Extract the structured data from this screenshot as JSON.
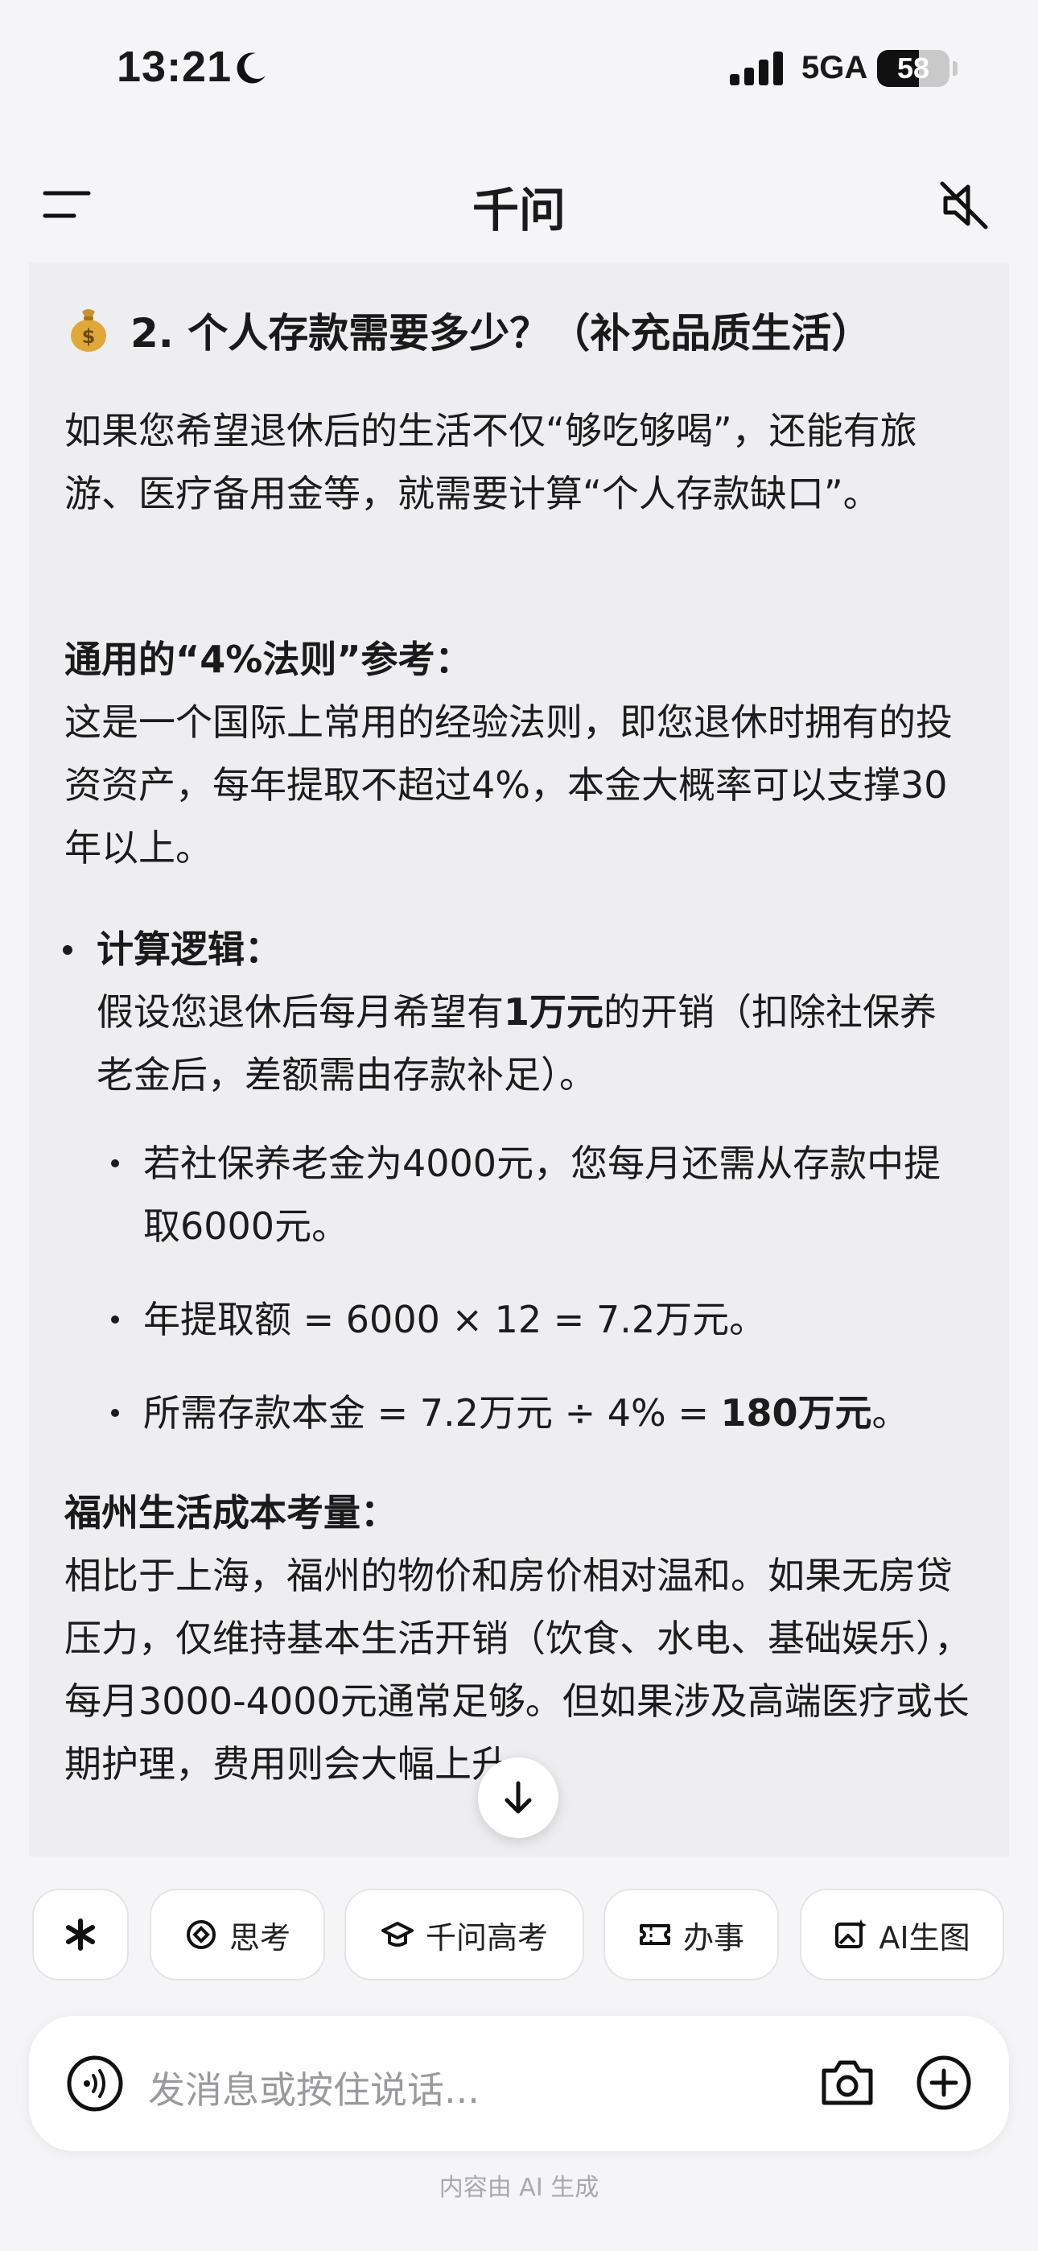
{
  "status_bar": {
    "time": "13:21",
    "network": "5GA",
    "battery": "58",
    "battery_level": 0.58
  },
  "header": {
    "title": "千问"
  },
  "content": {
    "section_title": "2. 个人存款需要多少？（补充品质生活）",
    "intro": "如果您希望退休后的生活不仅“够吃够喝”，还能有旅游、医疗备用金等，就需要计算“个人存款缺口”。",
    "rule_head": "通用的“4%法则”参考：",
    "rule_body": "这是一个国际上常用的经验法则，即您退休时拥有的投资资产，每年提取不超过4%，本金大概率可以支撑30年以上。",
    "calc_head": "计算逻辑：",
    "calc_body_pre": "假设您退休后每月希望有",
    "calc_body_bold": "1万元",
    "calc_body_post": "的开销（扣除社保养老金后，差额需由存款补足）。",
    "sub_items": [
      "若社保养老金为4000元，您每月还需从存款中提取6000元。",
      "年提取额 = 6000 × 12 = 7.2万元。"
    ],
    "sub_item_3_pre": "所需存款本金 = 7.2万元 ÷ 4% = ",
    "sub_item_3_bold": "180万元",
    "sub_item_3_post": "。",
    "fuzhou_head": "福州生活成本考量：",
    "fuzhou_body": "相比于上海，福州的物价和房价相对温和。如果无房贷压力，仅维持基本生活开销（饮食、水电、基础娱乐），每月3000-4000元通常足够。但如果涉及高端医疗或长期护理，费用则会大幅上升。"
  },
  "chips": [
    {
      "label": "",
      "icon": "asterisk-icon"
    },
    {
      "label": "思考",
      "icon": "think-icon"
    },
    {
      "label": "千问高考",
      "icon": "graduation-cap-icon"
    },
    {
      "label": "办事",
      "icon": "ticket-icon"
    },
    {
      "label": "AI生图",
      "icon": "image-spark-icon"
    }
  ],
  "input": {
    "placeholder": "发消息或按住说话..."
  },
  "footer_note": "内容由 AI 生成"
}
